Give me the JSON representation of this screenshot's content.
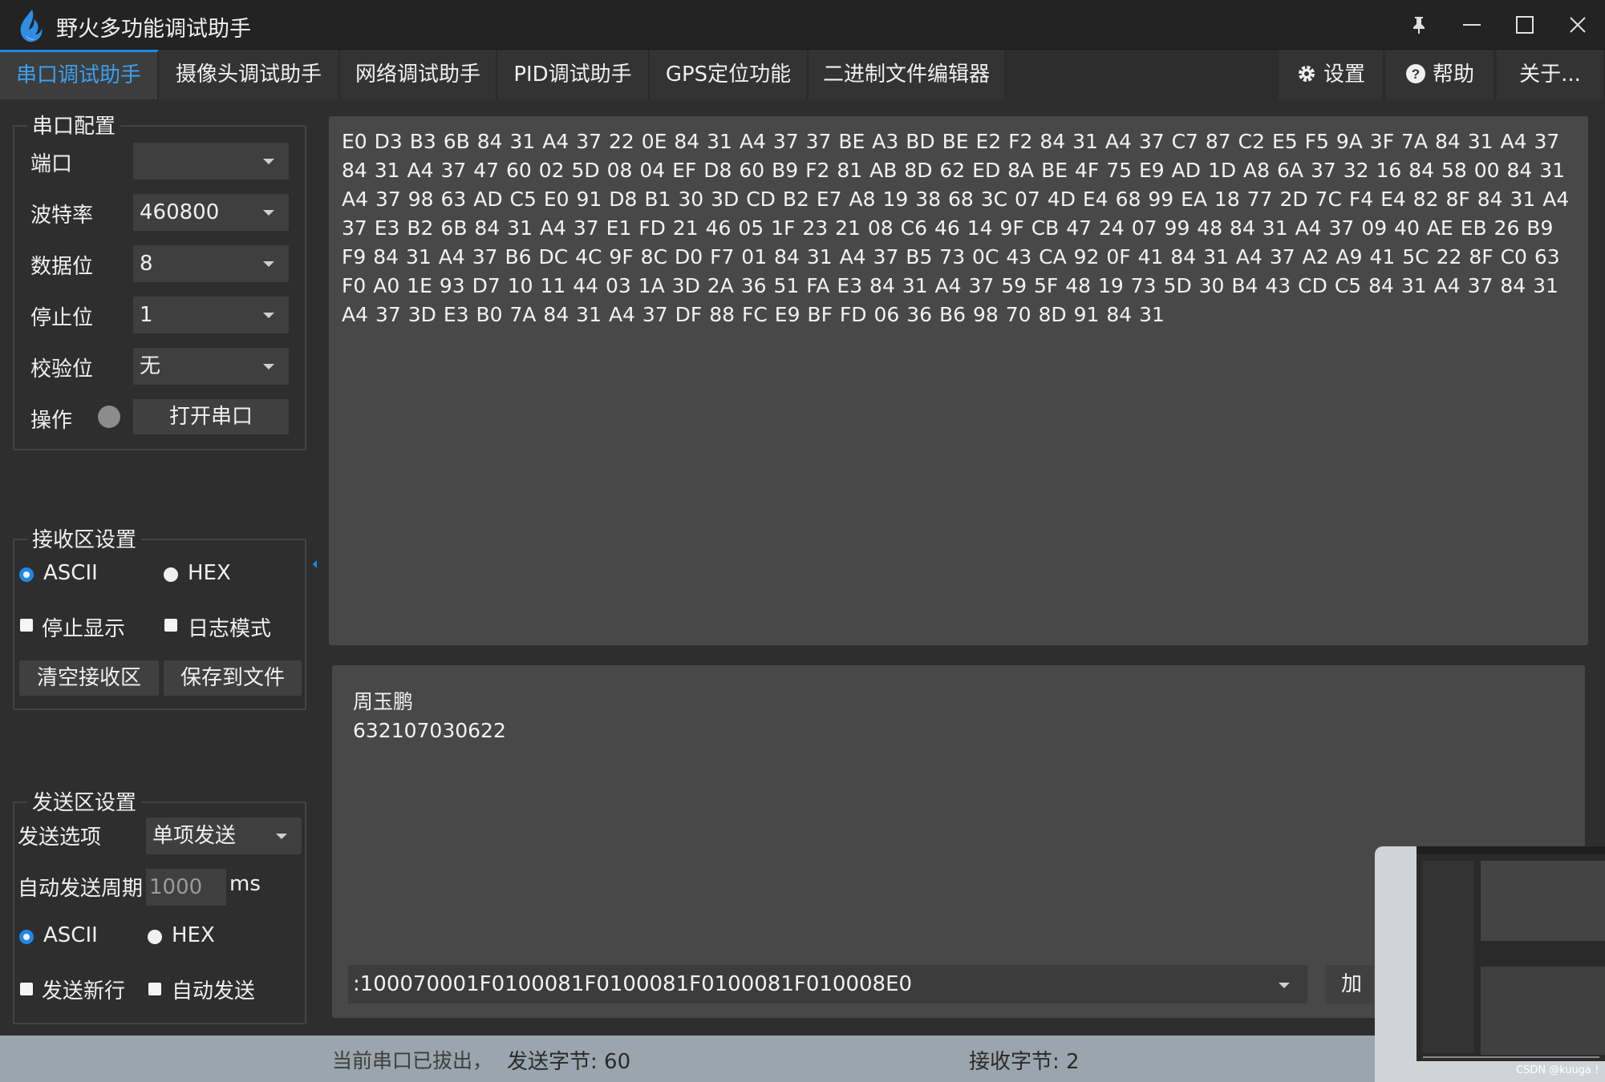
{
  "window": {
    "title": "野火多功能调试助手"
  },
  "tabs": [
    {
      "label": "串口调试助手",
      "active": true
    },
    {
      "label": "摄像头调试助手"
    },
    {
      "label": "网络调试助手"
    },
    {
      "label": "PID调试助手"
    },
    {
      "label": "GPS定位功能"
    },
    {
      "label": "二进制文件编辑器"
    }
  ],
  "right_tabs": {
    "settings": "设置",
    "help": "帮助",
    "about": "关于..."
  },
  "serial_config": {
    "title": "串口配置",
    "port_label": "端口",
    "port_value": "",
    "baud_label": "波特率",
    "baud_value": "460800",
    "databits_label": "数据位",
    "databits_value": "8",
    "stopbits_label": "停止位",
    "stopbits_value": "1",
    "parity_label": "校验位",
    "parity_value": "无",
    "op_label": "操作",
    "open_button": "打开串口"
  },
  "recv_settings": {
    "title": "接收区设置",
    "ascii": "ASCII",
    "hex": "HEX",
    "stop_display": "停止显示",
    "log_mode": "日志模式",
    "clear_button": "清空接收区",
    "save_button": "保存到文件"
  },
  "send_settings": {
    "title": "发送区设置",
    "option_label": "发送选项",
    "option_value": "单项发送",
    "period_label": "自动发送周期",
    "period_value": "1000",
    "period_unit": "ms",
    "ascii": "ASCII",
    "hex": "HEX",
    "newline": "发送新行",
    "auto_send": "自动发送"
  },
  "receive_area": {
    "text": "E0 D3 B3 6B 84 31 A4 37 22 0E 84 31 A4 37 37 BE A3 BD BE E2 F2 84 31 A4 37 C7 87 C2 E5 F5 9A 3F 7A 84 31 A4 37 84 31 A4 37 47 60 02 5D 08 04 EF D8 60 B9 F2 81 AB 8D 62 ED 8A BE 4F 75 E9 AD 1D A8 6A 37 32 16 84 58 00 84 31 A4 37 98 63 AD C5 E0 91 D8 B1 30 3D CD B2 E7 A8 19 38 68 3C 07 4D E4 68 99 EA 18 77 2D 7C F4 E4 82 8F 84 31 A4 37 E3 B2 6B 84 31 A4 37 E1 FD 21 46 05 1F 23 21 08 C6 46 14 9F CB 47 24 07 99 48 84 31 A4 37 09 40 AE EB 26 B9 F9 84 31 A4 37 B6 DC 4C 9F 8C D0 F7 01 84 31 A4 37 B5 73 0C 43 CA 92 0F 41 84 31 A4 37 A2 A9 41 5C 22 8F C0 63 F0 A0 1E 93 D7 10 11 44 03 1A 3D 2A 36 51 FA E3 84 31 A4 37 59 5F 48 19 73 5D 30 B4 43 CD C5 84 31 A4 37 84 31 A4 37 3D E3 B0 7A 84 31 A4 37 DF 88 FC E9 BF FD 06 36 B6 98 70 8D 91 84 31"
  },
  "send_area": {
    "line1": "周玉鹏",
    "line2": "632107030622",
    "history_value": ":100070001F0100081F0100081F0100081F010008E0",
    "load_button": "加载"
  },
  "status": {
    "port_state": "当前串口已拔出，",
    "sent_bytes": "发送字节: 60",
    "recv_bytes": "接收字节: 2"
  },
  "thumbnail": {
    "caption": "CSDN @kuuga !"
  },
  "colors": {
    "accent": "#1e88e5",
    "active_tab_text": "#3aa0f0",
    "status_bar": "#9aa5ad"
  }
}
